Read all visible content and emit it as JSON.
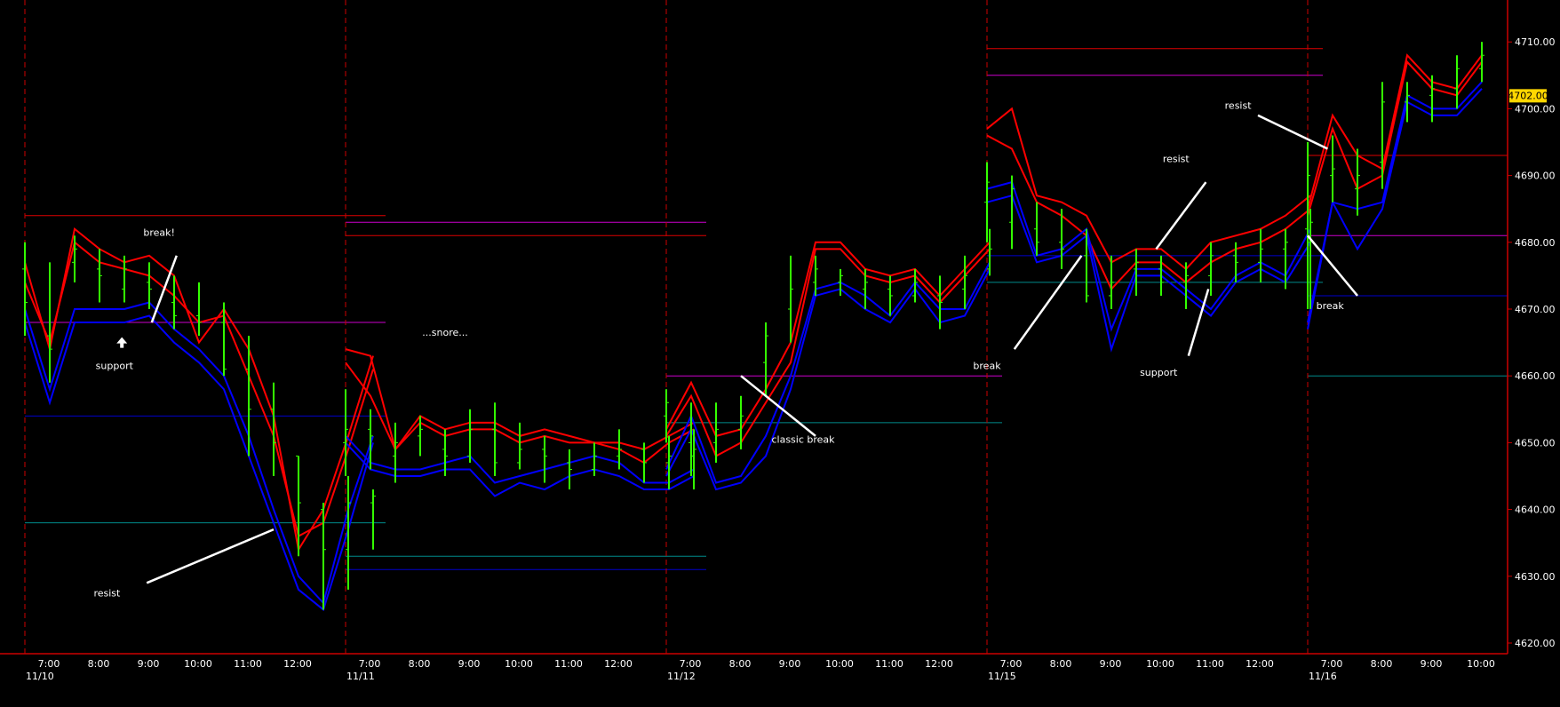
{
  "chart_data": {
    "type": "line",
    "title": "",
    "xlabel": "",
    "ylabel": "",
    "ylim": [
      4618,
      4714
    ],
    "last_price_label": "4702.00",
    "y_ticks": [
      "4620.00",
      "4630.00",
      "4640.00",
      "4650.00",
      "4660.00",
      "4670.00",
      "4680.00",
      "4690.00",
      "4700.00",
      "4710.00"
    ],
    "y_tick_values": [
      4620,
      4630,
      4640,
      4650,
      4660,
      4670,
      4680,
      4690,
      4700,
      4710
    ],
    "day_labels": [
      "11/10",
      "11/11",
      "11/12",
      "11/15",
      "11/16"
    ],
    "time_labels": [
      [
        "7:00",
        "8:00",
        "9:00",
        "10:00",
        "11:00",
        "12:00"
      ],
      [
        "7:00",
        "8:00",
        "9:00",
        "10:00",
        "11:00",
        "12:00"
      ],
      [
        "7:00",
        "8:00",
        "9:00",
        "10:00",
        "11:00",
        "12:00"
      ],
      [
        "7:00",
        "8:00",
        "9:00",
        "10:00",
        "11:00",
        "12:00"
      ],
      [
        "7:00",
        "8:00",
        "9:00",
        "10:00"
      ]
    ],
    "colors": {
      "background": "#000000",
      "price_bars": "#33ff00",
      "upper_band": "#ff0000",
      "lower_band": "#0000ff",
      "magenta_level": "#cc00cc",
      "teal_level": "#008b8b",
      "blue_level": "#0000cc",
      "red_level": "#dd0000",
      "session_divider": "#cc0000",
      "price_badge": "#ffd700"
    },
    "sessions": [
      {
        "date": "11/10",
        "bars": [
          [
            4680,
            4666,
            4676,
            4671
          ],
          [
            4677,
            4659,
            4666,
            4664
          ],
          [
            4681,
            4674,
            4677,
            4679
          ],
          [
            4679,
            4671,
            4676,
            4675
          ],
          [
            4678,
            4671,
            4673,
            4676
          ],
          [
            4677,
            4670,
            4674,
            4673
          ],
          [
            4675,
            4667,
            4671,
            4669
          ],
          [
            4674,
            4666,
            4669,
            4668
          ],
          [
            4671,
            4660,
            4668,
            4661
          ],
          [
            4666,
            4648,
            4661,
            4655
          ],
          [
            4659,
            4645,
            4655,
            4650
          ],
          [
            4648,
            4633,
            4648,
            4641
          ],
          [
            4641,
            4625,
            4640,
            4634
          ],
          [
            4645,
            4628,
            4634,
            4641
          ],
          [
            4643,
            4634,
            4641,
            4642
          ]
        ],
        "upper_1": [
          4677,
          4664,
          4682,
          4679,
          4677,
          4678,
          4675,
          4665,
          4670,
          4664,
          4654,
          4634,
          4640,
          4651,
          4663
        ],
        "upper_2": [
          4674,
          4665,
          4680,
          4677,
          4676,
          4675,
          4672,
          4668,
          4669,
          4660,
          4651,
          4636,
          4638,
          4649,
          4661
        ],
        "lower_1": [
          4670,
          4658,
          4670,
          4670,
          4670,
          4671,
          4667,
          4664,
          4660,
          4651,
          4640,
          4630,
          4626,
          4640,
          4651
        ],
        "lower_2": [
          4668,
          4656,
          4668,
          4668,
          4668,
          4669,
          4665,
          4662,
          4658,
          4648,
          4638,
          4628,
          4625,
          4637,
          4650
        ],
        "levels": [
          {
            "kind": "red",
            "value": 4684
          },
          {
            "kind": "magenta",
            "value": 4668
          },
          {
            "kind": "blue",
            "value": 4654
          },
          {
            "kind": "teal",
            "value": 4638
          }
        ]
      },
      {
        "date": "11/11",
        "bars": [
          [
            4658,
            4645,
            4650,
            4652
          ],
          [
            4655,
            4646,
            4652,
            4651
          ],
          [
            4653,
            4644,
            4648,
            4650
          ],
          [
            4654,
            4648,
            4651,
            4652
          ],
          [
            4652,
            4645,
            4649,
            4648
          ],
          [
            4655,
            4647,
            4648,
            4652
          ],
          [
            4656,
            4645,
            4652,
            4647
          ],
          [
            4653,
            4646,
            4647,
            4649
          ],
          [
            4651,
            4644,
            4649,
            4648
          ],
          [
            4649,
            4643,
            4647,
            4646
          ],
          [
            4650,
            4645,
            4646,
            4648
          ],
          [
            4652,
            4646,
            4648,
            4649
          ],
          [
            4650,
            4644,
            4649,
            4647
          ],
          [
            4651,
            4643,
            4647,
            4648
          ],
          [
            4652,
            4643,
            4648,
            4649
          ]
        ],
        "upper_1": [
          4664,
          4663,
          4649,
          4654,
          4652,
          4653,
          4653,
          4651,
          4652,
          4651,
          4650,
          4650,
          4649,
          4651,
          4653
        ],
        "upper_2": [
          4662,
          4657,
          4649,
          4653,
          4651,
          4652,
          4652,
          4650,
          4651,
          4650,
          4650,
          4649,
          4647,
          4650,
          4652
        ],
        "lower_1": [
          4651,
          4647,
          4646,
          4646,
          4647,
          4648,
          4644,
          4645,
          4646,
          4647,
          4648,
          4647,
          4644,
          4644,
          4646
        ],
        "lower_2": [
          4650,
          4646,
          4645,
          4645,
          4646,
          4646,
          4642,
          4644,
          4643,
          4645,
          4646,
          4645,
          4643,
          4643,
          4645
        ],
        "levels": [
          {
            "kind": "magenta",
            "value": 4683
          },
          {
            "kind": "red",
            "value": 4681
          },
          {
            "kind": "teal",
            "value": 4633
          },
          {
            "kind": "blue",
            "value": 4631
          }
        ]
      },
      {
        "date": "11/12",
        "bars": [
          [
            4658,
            4650,
            4654,
            4656
          ],
          [
            4656,
            4645,
            4650,
            4648
          ],
          [
            4656,
            4647,
            4650,
            4652
          ],
          [
            4657,
            4649,
            4652,
            4654
          ],
          [
            4668,
            4657,
            4662,
            4666
          ],
          [
            4678,
            4665,
            4670,
            4673
          ],
          [
            4678,
            4672,
            4674,
            4676
          ],
          [
            4676,
            4672,
            4674,
            4675
          ],
          [
            4676,
            4670,
            4673,
            4674
          ],
          [
            4675,
            4669,
            4673,
            4672
          ],
          [
            4676,
            4671,
            4672,
            4674
          ],
          [
            4675,
            4667,
            4672,
            4671
          ],
          [
            4678,
            4670,
            4673,
            4675
          ],
          [
            4682,
            4675,
            4676,
            4679
          ]
        ],
        "upper_1": [
          4652,
          4659,
          4651,
          4652,
          4658,
          4665,
          4680,
          4680,
          4676,
          4675,
          4676,
          4672,
          4676,
          4680
        ],
        "upper_2": [
          4651,
          4657,
          4648,
          4650,
          4656,
          4662,
          4679,
          4679,
          4675,
          4674,
          4675,
          4671,
          4675,
          4679
        ],
        "lower_1": [
          4646,
          4654,
          4644,
          4645,
          4651,
          4660,
          4673,
          4674,
          4672,
          4669,
          4674,
          4670,
          4670,
          4677
        ],
        "lower_2": [
          4645,
          4652,
          4643,
          4644,
          4648,
          4658,
          4672,
          4673,
          4670,
          4668,
          4673,
          4668,
          4669,
          4676
        ],
        "levels": [
          {
            "kind": "magenta",
            "value": 4660
          },
          {
            "kind": "teal",
            "value": 4653
          }
        ]
      },
      {
        "date": "11/15",
        "bars": [
          [
            4692,
            4680,
            4686,
            4689
          ],
          [
            4690,
            4679,
            4683,
            4688
          ],
          [
            4686,
            4678,
            4682,
            4680
          ],
          [
            4685,
            4676,
            4680,
            4679
          ],
          [
            4682,
            4671,
            4678,
            4672
          ],
          [
            4678,
            4670,
            4672,
            4674
          ],
          [
            4679,
            4672,
            4676,
            4677
          ],
          [
            4678,
            4672,
            4676,
            4674
          ],
          [
            4677,
            4670,
            4674,
            4675
          ],
          [
            4680,
            4672,
            4675,
            4678
          ],
          [
            4680,
            4674,
            4678,
            4677
          ],
          [
            4682,
            4674,
            4677,
            4679
          ],
          [
            4682,
            4673,
            4679,
            4680
          ],
          [
            4685,
            4670,
            4680,
            4683
          ]
        ],
        "upper_1": [
          4697,
          4700,
          4687,
          4686,
          4684,
          4677,
          4679,
          4679,
          4676,
          4680,
          4681,
          4682,
          4684,
          4687
        ],
        "upper_2": [
          4696,
          4694,
          4686,
          4684,
          4681,
          4673,
          4677,
          4677,
          4674,
          4677,
          4679,
          4680,
          4682,
          4685
        ],
        "lower_1": [
          4688,
          4689,
          4678,
          4679,
          4682,
          4667,
          4676,
          4676,
          4673,
          4670,
          4675,
          4677,
          4675,
          4682
        ],
        "lower_2": [
          4686,
          4687,
          4677,
          4678,
          4681,
          4664,
          4675,
          4675,
          4672,
          4669,
          4674,
          4676,
          4674,
          4680
        ],
        "levels": [
          {
            "kind": "red",
            "value": 4709
          },
          {
            "kind": "magenta",
            "value": 4705
          },
          {
            "kind": "blue",
            "value": 4678
          },
          {
            "kind": "teal",
            "value": 4674
          }
        ]
      },
      {
        "date": "11/16",
        "bars": [
          [
            4695,
            4670,
            4682,
            4690
          ],
          [
            4696,
            4686,
            4690,
            4691
          ],
          [
            4694,
            4684,
            4688,
            4690
          ],
          [
            4704,
            4688,
            4692,
            4701
          ],
          [
            4704,
            4698,
            4701,
            4702
          ],
          [
            4705,
            4698,
            4702,
            4703
          ],
          [
            4708,
            4700,
            4703,
            4706
          ],
          [
            4710,
            4704,
            4706,
            4708
          ]
        ],
        "upper_1": [
          4685,
          4699,
          4693,
          4691,
          4708,
          4704,
          4703,
          4708
        ],
        "upper_2": [
          4684,
          4697,
          4688,
          4690,
          4707,
          4703,
          4702,
          4707
        ],
        "lower_1": [
          4668,
          4686,
          4685,
          4686,
          4702,
          4700,
          4700,
          4704
        ],
        "lower_2": [
          4667,
          4686,
          4679,
          4685,
          4701,
          4699,
          4699,
          4703
        ],
        "levels": [
          {
            "kind": "red",
            "value": 4693
          },
          {
            "kind": "magenta",
            "value": 4681
          },
          {
            "kind": "blue",
            "value": 4672
          },
          {
            "kind": "teal",
            "value": 4660
          }
        ]
      }
    ],
    "annotations": [
      {
        "text": "break!",
        "session": 0,
        "pos": 5.4,
        "y": 4681,
        "ax": 6.1,
        "ay": 4678,
        "bx": 5.1,
        "by": 4668
      },
      {
        "text": "support",
        "session": 0,
        "pos": 3.6,
        "y": 4661,
        "arrow": "up",
        "ax": 3.9,
        "ay": 4665
      },
      {
        "text": "resist",
        "session": 0,
        "pos": 3.3,
        "y": 4627,
        "ax": 4.9,
        "ay": 4629,
        "bx": 10.0,
        "by": 4637
      },
      {
        "text": "...snore...",
        "session": 1,
        "pos": 4.0,
        "y": 4666
      },
      {
        "text": "classic break",
        "session": 2,
        "pos": 5.5,
        "y": 4650,
        "ax": 6.0,
        "ay": 4651,
        "bx": 3.0,
        "by": 4660
      },
      {
        "text": "break",
        "session": 3,
        "pos": 0.0,
        "y": 4661,
        "ax": 1.1,
        "ay": 4664,
        "bx": 3.8,
        "by": 4678
      },
      {
        "text": "resist",
        "session": 3,
        "pos": 7.6,
        "y": 4692,
        "ax": 8.8,
        "ay": 4689,
        "bx": 6.8,
        "by": 4679
      },
      {
        "text": "support",
        "session": 3,
        "pos": 6.9,
        "y": 4660,
        "ax": 8.1,
        "ay": 4663,
        "bx": 8.9,
        "by": 4673
      },
      {
        "text": "resist",
        "session": 4,
        "pos": -2.8,
        "y": 4700,
        "ax": -2.0,
        "ay": 4699,
        "bx": 0.8,
        "by": 4694
      },
      {
        "text": "break",
        "session": 4,
        "pos": 0.9,
        "y": 4670,
        "ax": 2.0,
        "ay": 4672,
        "bx": 0.0,
        "by": 4681
      }
    ]
  }
}
